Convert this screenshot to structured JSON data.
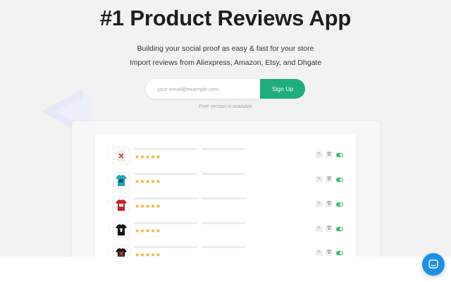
{
  "hero": {
    "title": "#1 Product Reviews App",
    "subtitle_1": "Building your social proof as easy & fast for your store",
    "subtitle_2": "Import reviews from Aliexpress, Amazon, Etsy, and Dhgate"
  },
  "signup": {
    "email_placeholder": "your-email@example.com",
    "button_label": "Sign Up",
    "free_note": "Free version is available"
  },
  "reviews": {
    "rows": [
      {
        "stars": "★★★★★",
        "thumbnail": "white-tshirt-red-print",
        "rating": 5,
        "enabled": true
      },
      {
        "stars": "★★★★★",
        "thumbnail": "teal-tshirt",
        "rating": 5,
        "enabled": true
      },
      {
        "stars": "★★★★★",
        "thumbnail": "red-tshirt",
        "rating": 5,
        "enabled": true
      },
      {
        "stars": "★★★★★",
        "thumbnail": "black-tshirt-print",
        "rating": 5,
        "enabled": true
      },
      {
        "stars": "★★★★★",
        "thumbnail": "black-tshirt-print",
        "rating": 5,
        "enabled": true
      }
    ],
    "edit_icon": "pencil-icon",
    "delete_icon": "trash-icon"
  },
  "colors": {
    "accent": "#1fae7a",
    "star": "#f5a623",
    "toggle_on": "#2dbd6e",
    "chat": "#1c8fe6"
  }
}
